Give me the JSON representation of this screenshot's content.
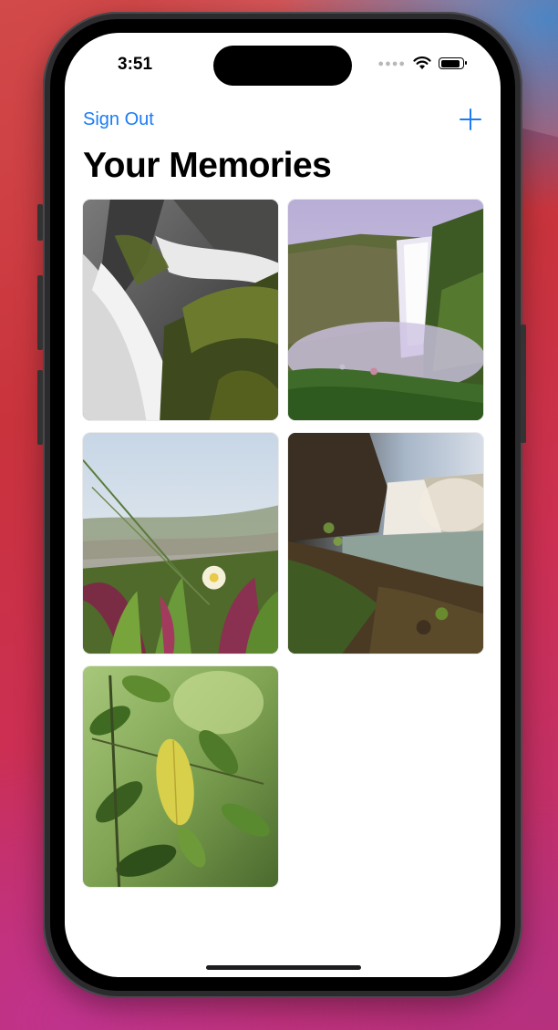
{
  "status_bar": {
    "time": "3:51",
    "battery_level": 0.9
  },
  "nav": {
    "sign_out_label": "Sign Out",
    "add_icon": "plus-icon"
  },
  "page": {
    "title": "Your Memories"
  },
  "memories": [
    {
      "subject": "black-and-white waterfall over mossy rocks"
    },
    {
      "subject": "misty waterfall over green cliff"
    },
    {
      "subject": "white flower among green and red succulents"
    },
    {
      "subject": "waterfall with rocky foreground at sunset"
    },
    {
      "subject": "green leaves with one yellow leaf"
    }
  ],
  "colors": {
    "accent": "#1a7cf5",
    "background": "#ffffff"
  }
}
